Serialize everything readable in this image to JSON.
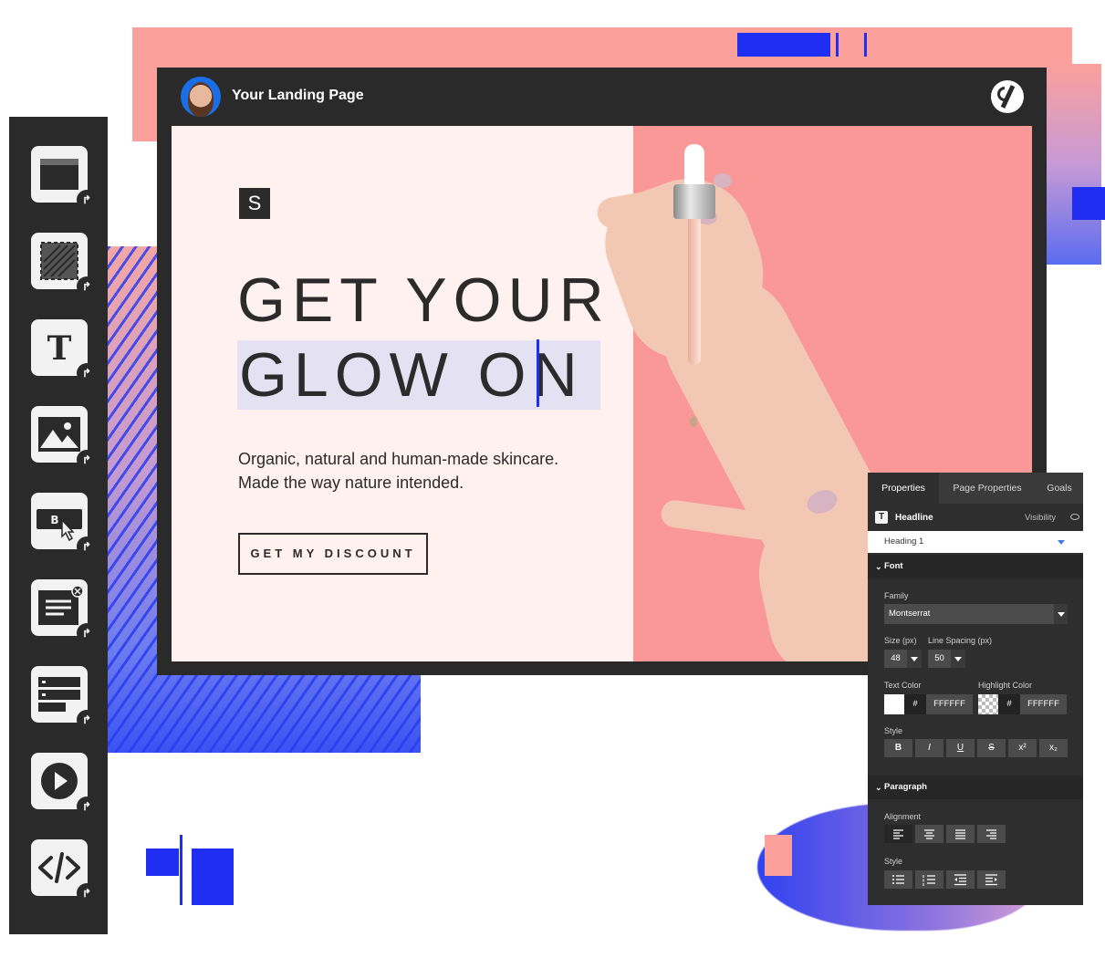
{
  "window": {
    "title": "Your Landing Page"
  },
  "landing": {
    "logo_letter": "S",
    "headline_line1": "GET YOUR",
    "headline_line2": "GLOW ON",
    "subtext": "Organic, natural and human-made skincare. Made the way nature intended.",
    "cta_label": "GET MY DISCOUNT"
  },
  "toolbar": {
    "tools": [
      {
        "name": "section",
        "icon": "section-icon"
      },
      {
        "name": "box",
        "icon": "box-icon"
      },
      {
        "name": "text",
        "icon": "text-icon"
      },
      {
        "name": "image",
        "icon": "image-icon"
      },
      {
        "name": "button",
        "icon": "button-icon"
      },
      {
        "name": "lightbox",
        "icon": "lightbox-icon"
      },
      {
        "name": "form",
        "icon": "form-icon"
      },
      {
        "name": "video",
        "icon": "video-icon"
      },
      {
        "name": "custom-html",
        "icon": "code-icon"
      }
    ]
  },
  "panel": {
    "tabs": [
      "Properties",
      "Page Properties",
      "Goals"
    ],
    "active_tab": "Properties",
    "element_label": "Headline",
    "visibility_label": "Visibility",
    "heading_select": "Heading 1",
    "font_section": "Font",
    "family_label": "Family",
    "family_value": "Montserrat",
    "size_label": "Size (px)",
    "size_value": "48",
    "line_spacing_label": "Line Spacing (px)",
    "line_spacing_value": "50",
    "text_color_label": "Text Color",
    "text_color_hash": "#",
    "text_color_value": "FFFFFF",
    "highlight_color_label": "Highlight Color",
    "highlight_color_hash": "#",
    "highlight_color_value": "FFFFFF",
    "style_label": "Style",
    "style_buttons": [
      "B",
      "I",
      "U",
      "S",
      "x²",
      "x₂"
    ],
    "paragraph_section": "Paragraph",
    "alignment_label": "Alignment",
    "list_style_label": "Style"
  },
  "colors": {
    "editor_bg": "#2a2a2a",
    "canvas_left": "#fff1ef",
    "canvas_right": "#f99896",
    "accent_blue": "#1f2ef0",
    "salmon": "#fba09b"
  }
}
